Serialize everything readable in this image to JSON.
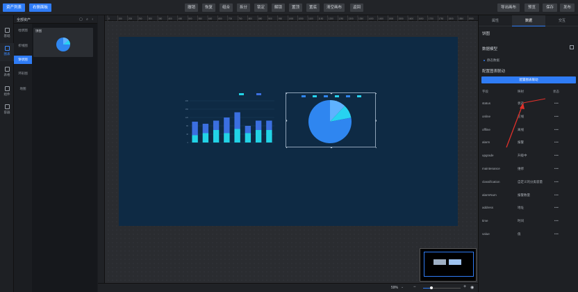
{
  "topbar": {
    "asset_list": "资产列表",
    "layer_panel": "右侧面板",
    "tools": [
      "撤销",
      "恢复",
      "组合",
      "拆分",
      "锁定",
      "解锁",
      "置顶",
      "置底",
      "清空画布",
      "返回"
    ],
    "right_tools": [
      "导出画布",
      "预览",
      "保存",
      "发布"
    ]
  },
  "leftnav": [
    "基础",
    "图表",
    "表格",
    "组件",
    "容器"
  ],
  "asset_panel": {
    "title": "全部资产",
    "tools": "▢ ⌕ ‹",
    "categories": [
      "柱状图",
      "折线图",
      "饼状图",
      "环形图",
      "地图"
    ],
    "cards": [
      {
        "label": "饼图"
      }
    ]
  },
  "ruler_ticks": [
    "0",
    "150",
    "200",
    "250",
    "300",
    "350",
    "400",
    "450",
    "500",
    "550",
    "600",
    "650",
    "700",
    "750",
    "800",
    "850",
    "900",
    "950",
    "1000",
    "1050",
    "1100",
    "1150",
    "1200",
    "1250",
    "1300",
    "1350",
    "1400",
    "1450",
    "1500",
    "1550",
    "1600",
    "1650",
    "1700",
    "1750",
    "1800",
    "1850",
    "1900"
  ],
  "charts": {
    "bar": {
      "legend": [
        "",
        "",
        ""
      ],
      "categories": [
        "",
        "",
        "",
        "",
        "",
        "",
        "",
        ""
      ],
      "series_a": [
        100,
        90,
        105,
        120,
        145,
        80,
        105,
        105
      ],
      "series_b": [
        35,
        45,
        60,
        45,
        65,
        45,
        60,
        60
      ],
      "ylim": [
        0,
        200
      ],
      "colors": {
        "a": "#3b6fe0",
        "b": "#22d3e6"
      }
    },
    "pie": {
      "legend": [
        "",
        "",
        "",
        "",
        "",
        ""
      ],
      "values": [
        78,
        12,
        10
      ],
      "colors": [
        "#2f86f0",
        "#5fb2ff",
        "#27d3f0"
      ]
    }
  },
  "bottombar": {
    "zoom": "59%",
    "zoom_out": "−",
    "zoom_in": "+"
  },
  "rightpanel": {
    "tabs": [
      "属性",
      "数据",
      "交互"
    ],
    "title": "饼图",
    "data_model": "数据模型",
    "static_data": "静态数据",
    "config_linkage": "配置图表联动",
    "config_button": "配置图表联动",
    "headers": {
      "field": "字段",
      "mapping": "映射",
      "status": "状态"
    },
    "rows": [
      {
        "field": "status",
        "mapping": "状态",
        "status": "•••"
      },
      {
        "field": "online",
        "mapping": "在线",
        "status": "•••"
      },
      {
        "field": "offline",
        "mapping": "离线",
        "status": "•••"
      },
      {
        "field": "alarm",
        "mapping": "报警",
        "status": "•••"
      },
      {
        "field": "upgrade",
        "mapping": "升级中",
        "status": "•••"
      },
      {
        "field": "maintenance",
        "mapping": "维修",
        "status": "•••"
      },
      {
        "field": "classification",
        "mapping": "自定义的分类容量",
        "status": "•••"
      },
      {
        "field": "alarmNum",
        "mapping": "报警数量",
        "status": "•••"
      },
      {
        "field": "address",
        "mapping": "地址",
        "status": "•••"
      },
      {
        "field": "time",
        "mapping": "时间",
        "status": "•••"
      },
      {
        "field": "value",
        "mapping": "值",
        "status": "•••"
      }
    ]
  }
}
